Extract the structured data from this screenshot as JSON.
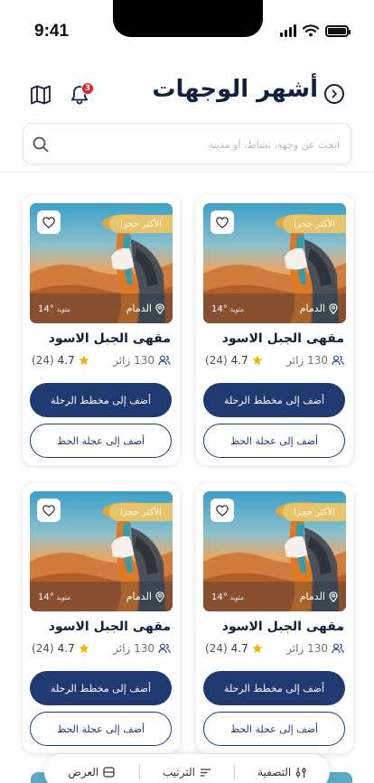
{
  "status_bar": {
    "time": "9:41"
  },
  "header": {
    "title": "أشهر الوجهات",
    "notification_count": "3"
  },
  "search": {
    "placeholder": "ابحث عن وجهة، نشاط، أو مدينة"
  },
  "cards": [
    {
      "badge": "الأكثر حجزا",
      "location": "الدمام",
      "temperature": "14°",
      "temp_unit": "مئوية",
      "title": "مقهى الجبل الاسود",
      "visitors": "130 زائر",
      "rating": "4.7",
      "reviews": "(24)",
      "primary_action": "أضف إلى مخطط الرحلة",
      "secondary_action": "أضف إلى عجلة الحظ"
    },
    {
      "badge": "الأكثر حجزا",
      "location": "الدمام",
      "temperature": "14°",
      "temp_unit": "مئوية",
      "title": "مقهى الجبل الاسود",
      "visitors": "130 زائر",
      "rating": "4.7",
      "reviews": "(24)",
      "primary_action": "أضف إلى مخطط الرحلة",
      "secondary_action": "أضف إلى عجلة الحظ"
    },
    {
      "badge": "الأكثر حجزا",
      "location": "الدمام",
      "temperature": "14°",
      "temp_unit": "مئوية",
      "title": "مقهى الجبل الاسود",
      "visitors": "130 زائر",
      "rating": "4.7",
      "reviews": "(24)",
      "primary_action": "أضف إلى مخطط الرحلة",
      "secondary_action": "أضف إلى عجلة الحظ"
    },
    {
      "badge": "الأكثر حجزا",
      "location": "الدمام",
      "temperature": "14°",
      "temp_unit": "مئوية",
      "title": "مقهى الجبل الاسود",
      "visitors": "130 زائر",
      "rating": "4.7",
      "reviews": "(24)",
      "primary_action": "أضف إلى مخطط الرحلة",
      "secondary_action": "أضف إلى عجلة الحظ"
    }
  ],
  "bottom_bar": {
    "filter": "التصفية",
    "sort": "الترتيب",
    "view": "العرض"
  },
  "colors": {
    "primary": "#1f3a70",
    "badge": "#e8c46a",
    "star": "#f5b301",
    "notification": "#e0242b"
  }
}
